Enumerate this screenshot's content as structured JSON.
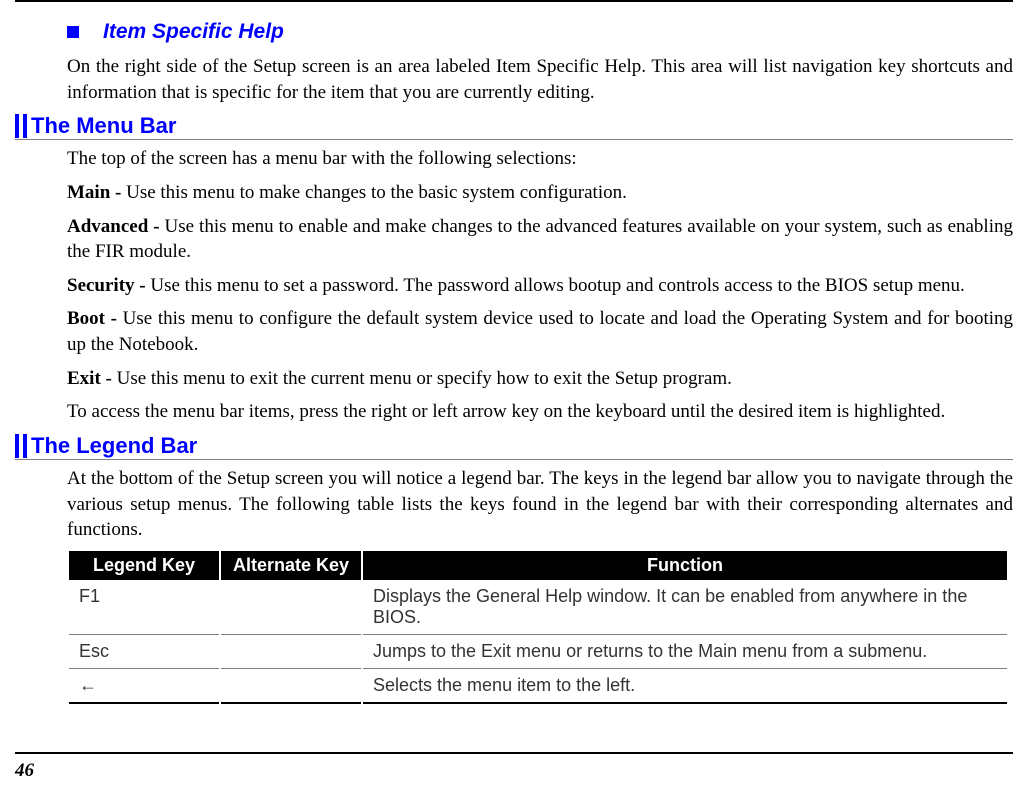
{
  "section1": {
    "title": "Item Specific Help",
    "para": "On the right side of the Setup screen is an area labeled Item Specific Help.  This area will list navigation key shortcuts and information that is specific for the item that you are currently editing."
  },
  "section2": {
    "heading": "The Menu Bar",
    "intro": "The top of the screen has a menu bar with the following selections:",
    "items": [
      {
        "label": "Main - ",
        "desc": "Use this menu to make changes to the basic system configuration."
      },
      {
        "label": "Advanced - ",
        "desc": "Use this menu to enable and make changes to the advanced features available on your system, such as enabling the FIR module."
      },
      {
        "label": "Security - ",
        "desc": "Use this menu to set a password. The password allows bootup and controls access to the BIOS setup menu."
      },
      {
        "label": "Boot - ",
        "desc": "Use this menu to configure the default system device used to locate and load the Operating System and for booting up the Notebook."
      },
      {
        "label": "Exit - ",
        "desc": "Use this menu to exit the current menu or specify how to exit the Setup program."
      }
    ],
    "outro": "To access the menu bar items, press the right or left arrow key on the keyboard until the desired item is highlighted."
  },
  "section3": {
    "heading": "The Legend Bar",
    "para": "At the bottom of the Setup screen you will notice a legend bar. The keys in the legend bar allow you to navigate through the various setup menus. The following table lists the keys found in the legend bar with their corresponding alternates and functions.",
    "table": {
      "headers": [
        "Legend Key",
        "Alternate Key",
        "Function"
      ],
      "rows": [
        {
          "key": "F1",
          "alt": "",
          "func": "Displays the General Help window.  It can be enabled from anywhere in the BIOS."
        },
        {
          "key": "Esc",
          "alt": "",
          "func": "Jumps to the Exit menu or returns to the Main menu from a submenu."
        },
        {
          "key": "←",
          "alt": "",
          "func": "Selects the menu item to the left."
        }
      ]
    }
  },
  "page_number": "46"
}
